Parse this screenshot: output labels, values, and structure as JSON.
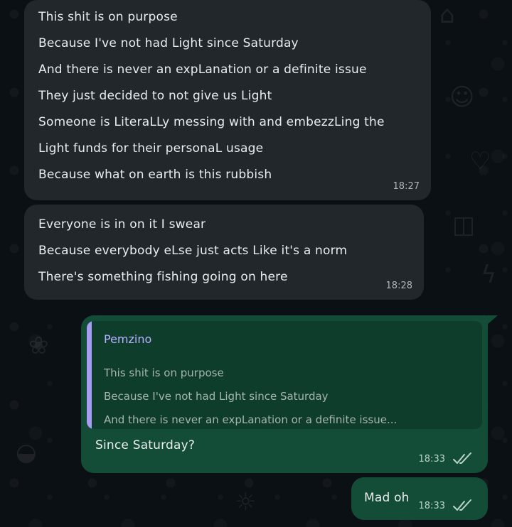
{
  "messages": [
    {
      "direction": "incoming",
      "lines": [
        "This shit is on purpose",
        "Because I've not had Light since Saturday",
        "And there is never an expLanation or a definite issue",
        "They just decided to not give us Light",
        "Someone is LiteraLLy messing with and embezzLing the",
        "Light funds for their personaL usage",
        "Because what on earth is this rubbish"
      ],
      "time": "18:27"
    },
    {
      "direction": "incoming",
      "lines": [
        "Everyone is in on it I swear",
        "Because everybody eLse just acts Like it's a norm",
        "There's something fishing going on here"
      ],
      "time": "18:28"
    },
    {
      "direction": "outgoing",
      "quote": {
        "author": "Pemzino",
        "lines": [
          "This shit is on purpose",
          "Because I've not had Light since Saturday",
          "And there is never an expLanation or a definite issue..."
        ]
      },
      "text": "Since Saturday?",
      "time": "18:33",
      "status_icon": "double-check-read-icon"
    },
    {
      "direction": "outgoing",
      "text": "Mad oh",
      "time": "18:33",
      "status_icon": "double-check-read-icon"
    }
  ],
  "colors": {
    "background": "#0b1014",
    "incoming_bubble": "#22272b",
    "outgoing_bubble": "#144d37",
    "quote_background": "#0f3d2c",
    "quote_accent": "#a89cf7",
    "text": "#e9edef"
  },
  "wallpaper_icons": [
    "house-icon",
    "heart-icon",
    "camera-icon",
    "lightning-icon",
    "paw-icon",
    "taco-icon",
    "sun-icon",
    "smiley-icon"
  ]
}
